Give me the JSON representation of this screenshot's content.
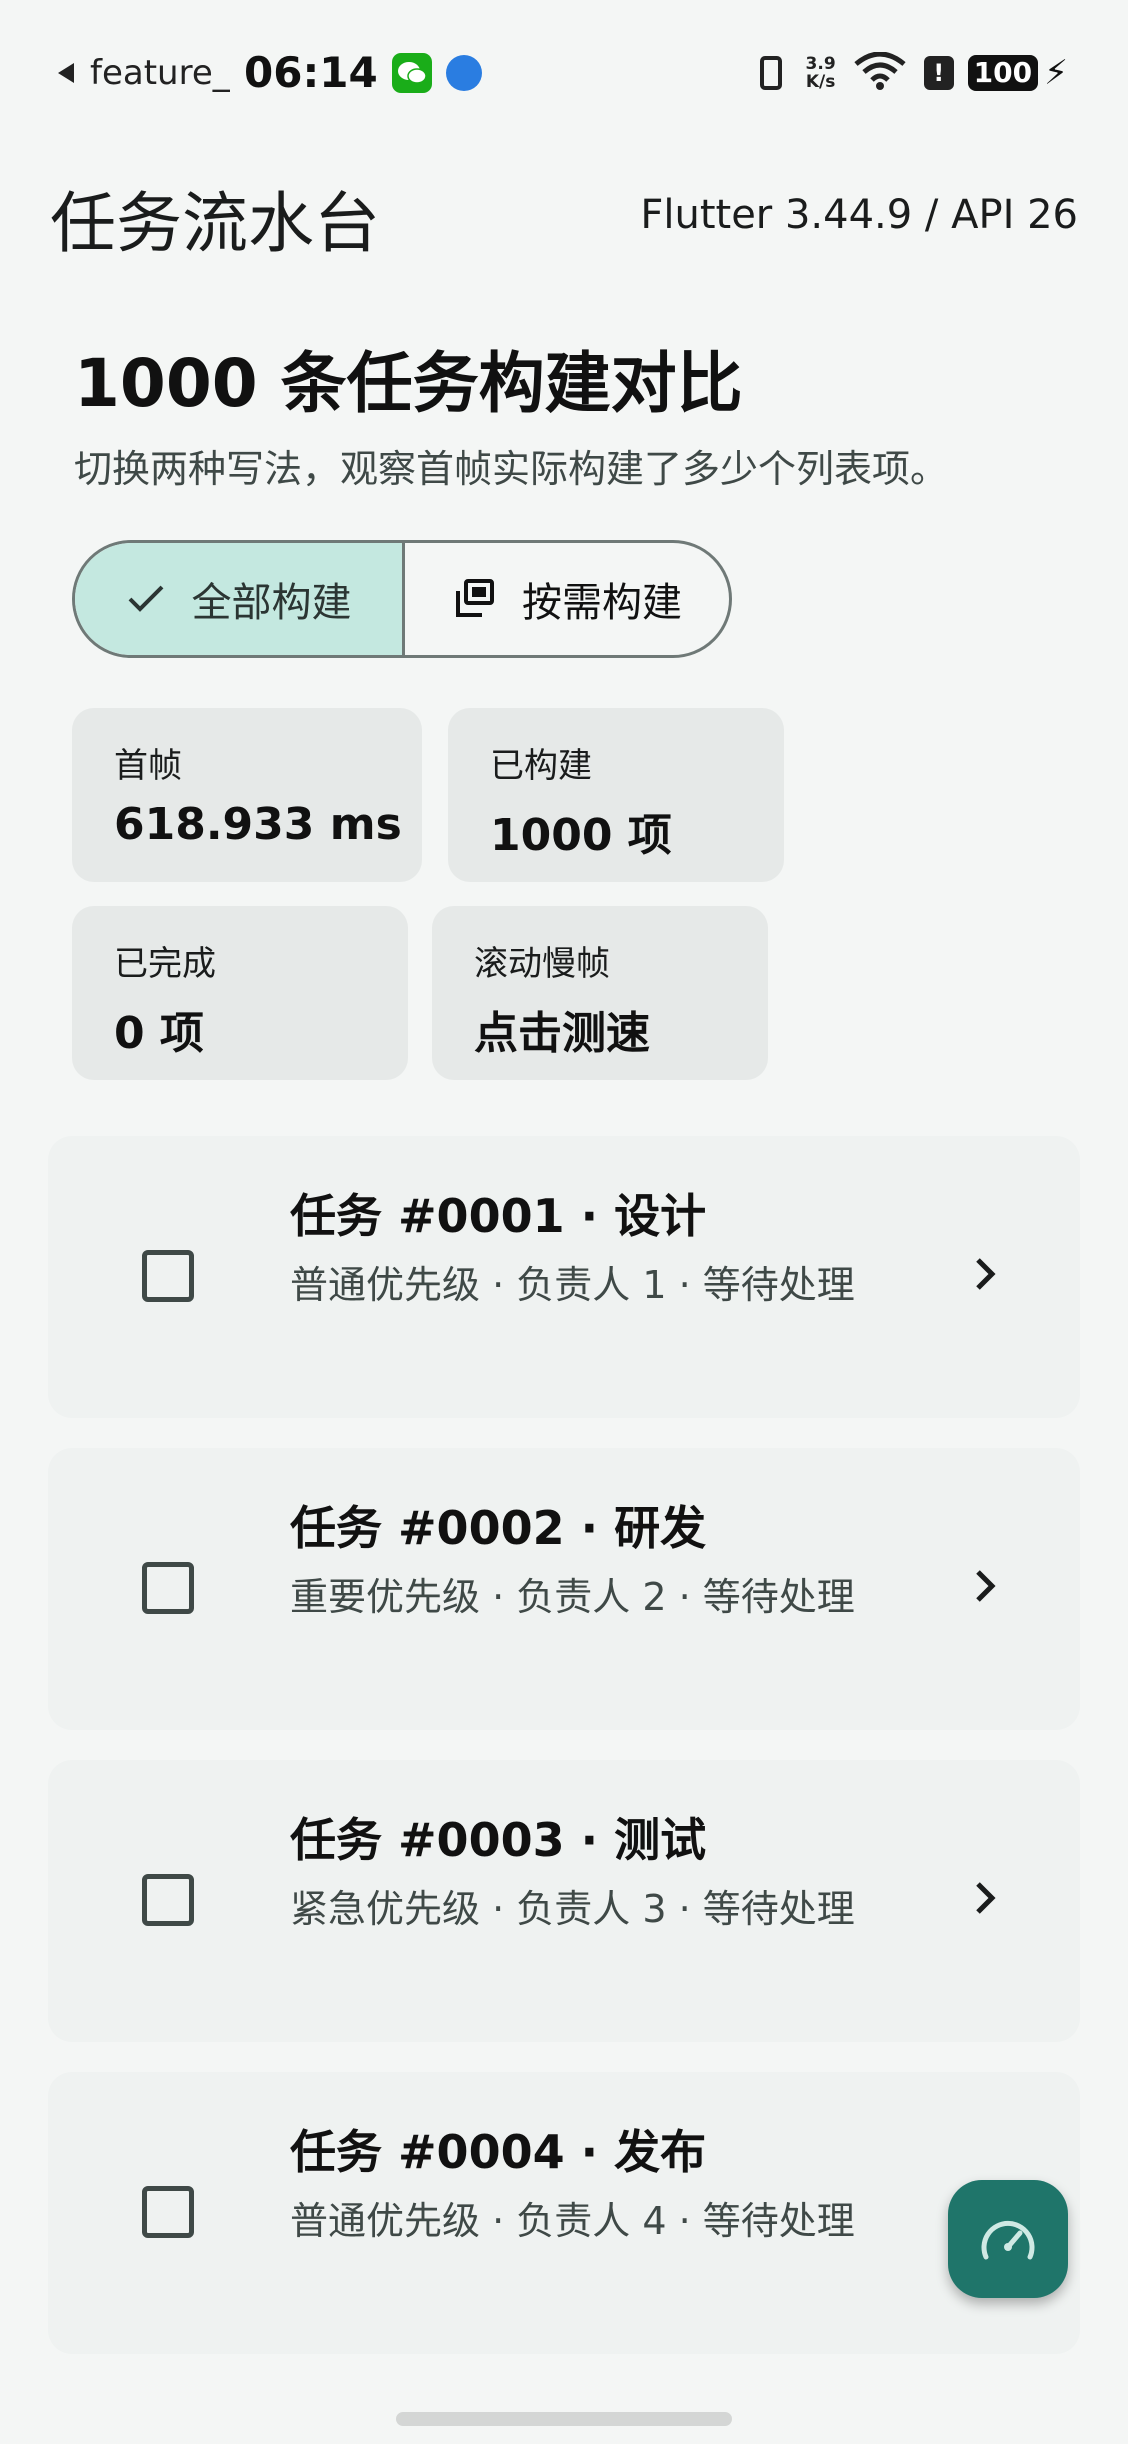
{
  "status_bar": {
    "app_name": "feature_g",
    "time": "06:14",
    "net_speed_top": "3.9",
    "net_speed_bottom": "K/s",
    "alert": "!",
    "battery": "100",
    "icons": [
      "back-arrow-icon",
      "wechat-icon",
      "globe-icon",
      "vibrate-icon",
      "wifi-icon",
      "alert-icon",
      "battery-icon",
      "charging-bolt-icon"
    ]
  },
  "app_bar": {
    "title": "任务流水台",
    "version": "Flutter 3.44.9 / API 26"
  },
  "header": {
    "headline": "1000 条任务构建对比",
    "subline": "切换两种写法，观察首帧实际构建了多少个列表项。"
  },
  "segmented": {
    "options": [
      {
        "label": "全部构建",
        "selected": true,
        "icon": "check-icon"
      },
      {
        "label": "按需构建",
        "selected": false,
        "icon": "layers-icon"
      }
    ],
    "selected_color": "#c4e8e0"
  },
  "stats": [
    {
      "label": "首帧",
      "value": "618.933 ms"
    },
    {
      "label": "已构建",
      "value": "1000 项"
    },
    {
      "label": "已完成",
      "value": "0 项"
    },
    {
      "label": "滚动慢帧",
      "value": "点击测速"
    }
  ],
  "tasks": [
    {
      "title": "任务 #0001 · 设计",
      "subtitle": "普通优先级 · 负责人 1 · 等待处理",
      "checked": false
    },
    {
      "title": "任务 #0002 · 研发",
      "subtitle": "重要优先级 · 负责人 2 · 等待处理",
      "checked": false
    },
    {
      "title": "任务 #0003 · 测试",
      "subtitle": "紧急优先级 · 负责人 3 · 等待处理",
      "checked": false
    },
    {
      "title": "任务 #0004 · 发布",
      "subtitle": "普通优先级 · 负责人 4 · 等待处理",
      "checked": false
    }
  ],
  "fab": {
    "icon": "speedometer-icon",
    "color": "#1f756a"
  }
}
